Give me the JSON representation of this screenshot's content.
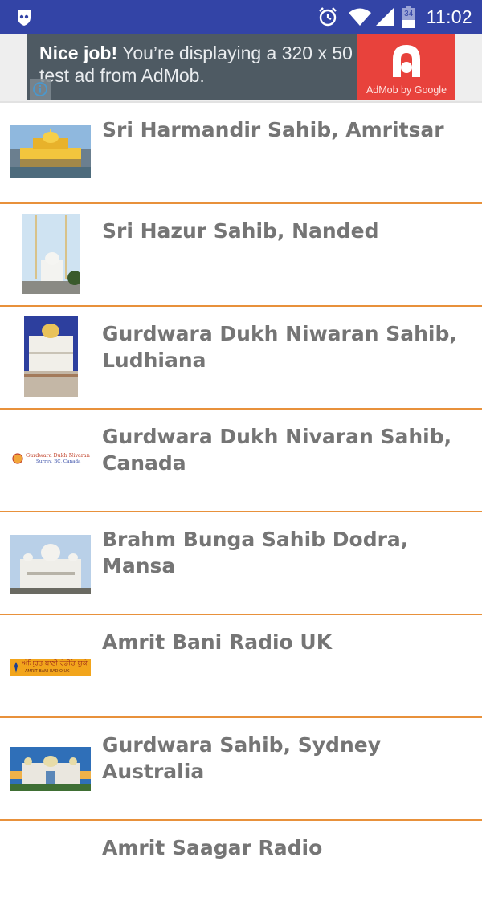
{
  "status_bar": {
    "time": "11:02",
    "battery_level": "34",
    "icons": [
      "app-shield-icon",
      "alarm-icon",
      "wifi-icon",
      "signal-icon",
      "battery-icon"
    ]
  },
  "ad": {
    "headline": "Nice job!",
    "body": " You’re displaying a 320 x 50 test ad from AdMob.",
    "brand": "AdMob by Google",
    "info_icon": "info-icon",
    "colors": {
      "banner": "#4e5a63",
      "logo_bg": "#e8423c"
    }
  },
  "list": {
    "divider_color": "#e8913b",
    "items": [
      {
        "title": "Sri Harmandir Sahib, Amritsar",
        "thumbnail": "golden-temple-photo"
      },
      {
        "title": "Sri Hazur Sahib, Nanded",
        "thumbnail": "hazur-sahib-photo"
      },
      {
        "title": "Gurdwara Dukh Niwaran Sahib, Ludhiana",
        "thumbnail": "dukh-niwaran-ludhiana-photo"
      },
      {
        "title": "Gurdwara Dukh Nivaran Sahib, Canada",
        "thumbnail": "dukh-nivaran-canada-logo",
        "logo_text_1": "Gurdwara Dukh Nivaran Sahib",
        "logo_text_2": "Surrey, BC, Canada"
      },
      {
        "title": "Brahm Bunga Sahib Dodra, Mansa",
        "thumbnail": "brahm-bunga-photo"
      },
      {
        "title": "Amrit Bani Radio UK",
        "thumbnail": "amrit-bani-radio-logo",
        "logo_text_1": "ਅੰਮ੍ਰਿਤ ਬਾਣੀ ਰੇਡੀਓ ਯੂਕੇ",
        "logo_text_2": "AMRIT BANI RADIO UK"
      },
      {
        "title": "Gurdwara Sahib, Sydney Australia",
        "thumbnail": "sydney-gurdwara-photo"
      },
      {
        "title": "Amrit Saagar Radio",
        "thumbnail": ""
      }
    ]
  }
}
